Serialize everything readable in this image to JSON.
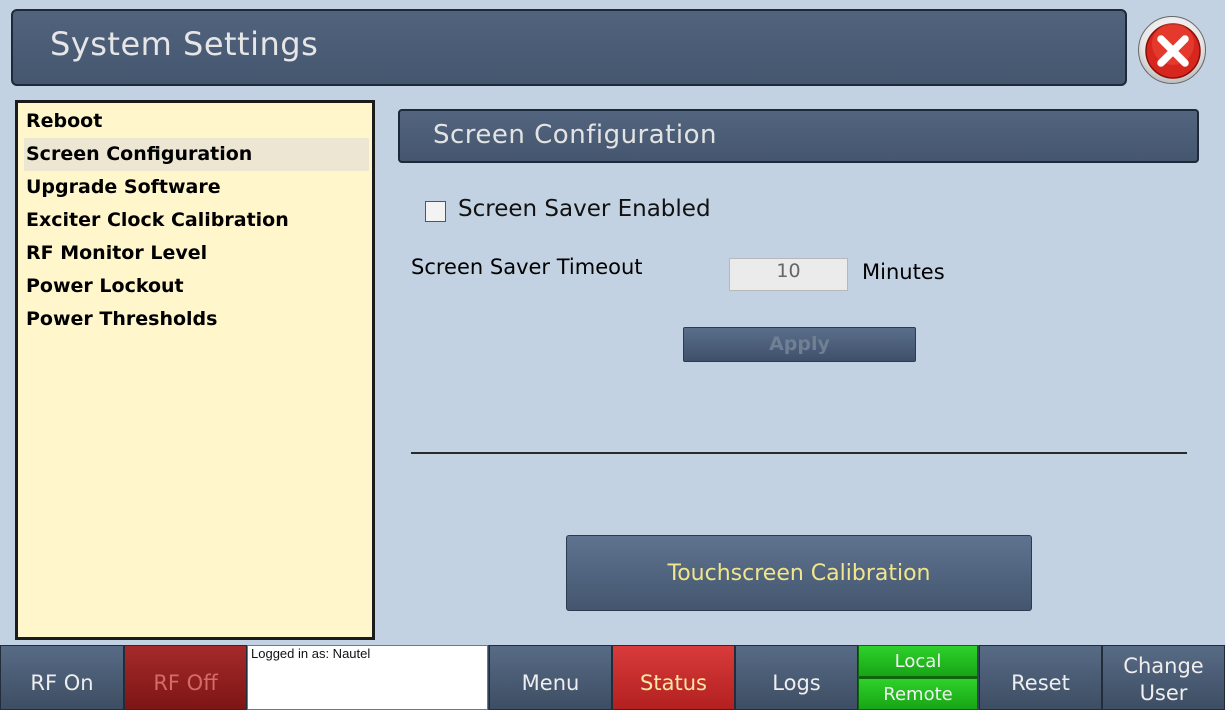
{
  "window": {
    "title": "System Settings",
    "close_icon": "close-icon"
  },
  "sidebar": {
    "items": [
      {
        "label": "Reboot"
      },
      {
        "label": "Screen Configuration"
      },
      {
        "label": "Upgrade Software"
      },
      {
        "label": "Exciter Clock Calibration"
      },
      {
        "label": "RF Monitor Level"
      },
      {
        "label": "Power Lockout"
      },
      {
        "label": "Power Thresholds"
      }
    ],
    "selected": "Screen Configuration"
  },
  "panel": {
    "title": "Screen Configuration",
    "screen_saver_label": "Screen Saver Enabled",
    "screen_saver_checked": false,
    "timeout_label": "Screen Saver Timeout",
    "timeout_value": "10",
    "timeout_unit": "Minutes",
    "apply_label": "Apply",
    "touchscreen_label": "Touchscreen Calibration"
  },
  "bottom_bar": {
    "rf_on": "RF On",
    "rf_off": "RF Off",
    "logged_in": "Logged in as: Nautel",
    "menu": "Menu",
    "status": "Status",
    "logs": "Logs",
    "local": "Local",
    "remote": "Remote",
    "reset": "Reset",
    "change_user_line1": "Change",
    "change_user_line2": "User"
  },
  "colors": {
    "background": "#c3d2e2",
    "title_bar": "#4a5b74",
    "sidebar_bg": "#fff6cc",
    "status_red": "#d83b3b",
    "rf_off_red": "#7d1515",
    "local_green": "#2ed12a",
    "touch_text": "#f2e68a"
  }
}
